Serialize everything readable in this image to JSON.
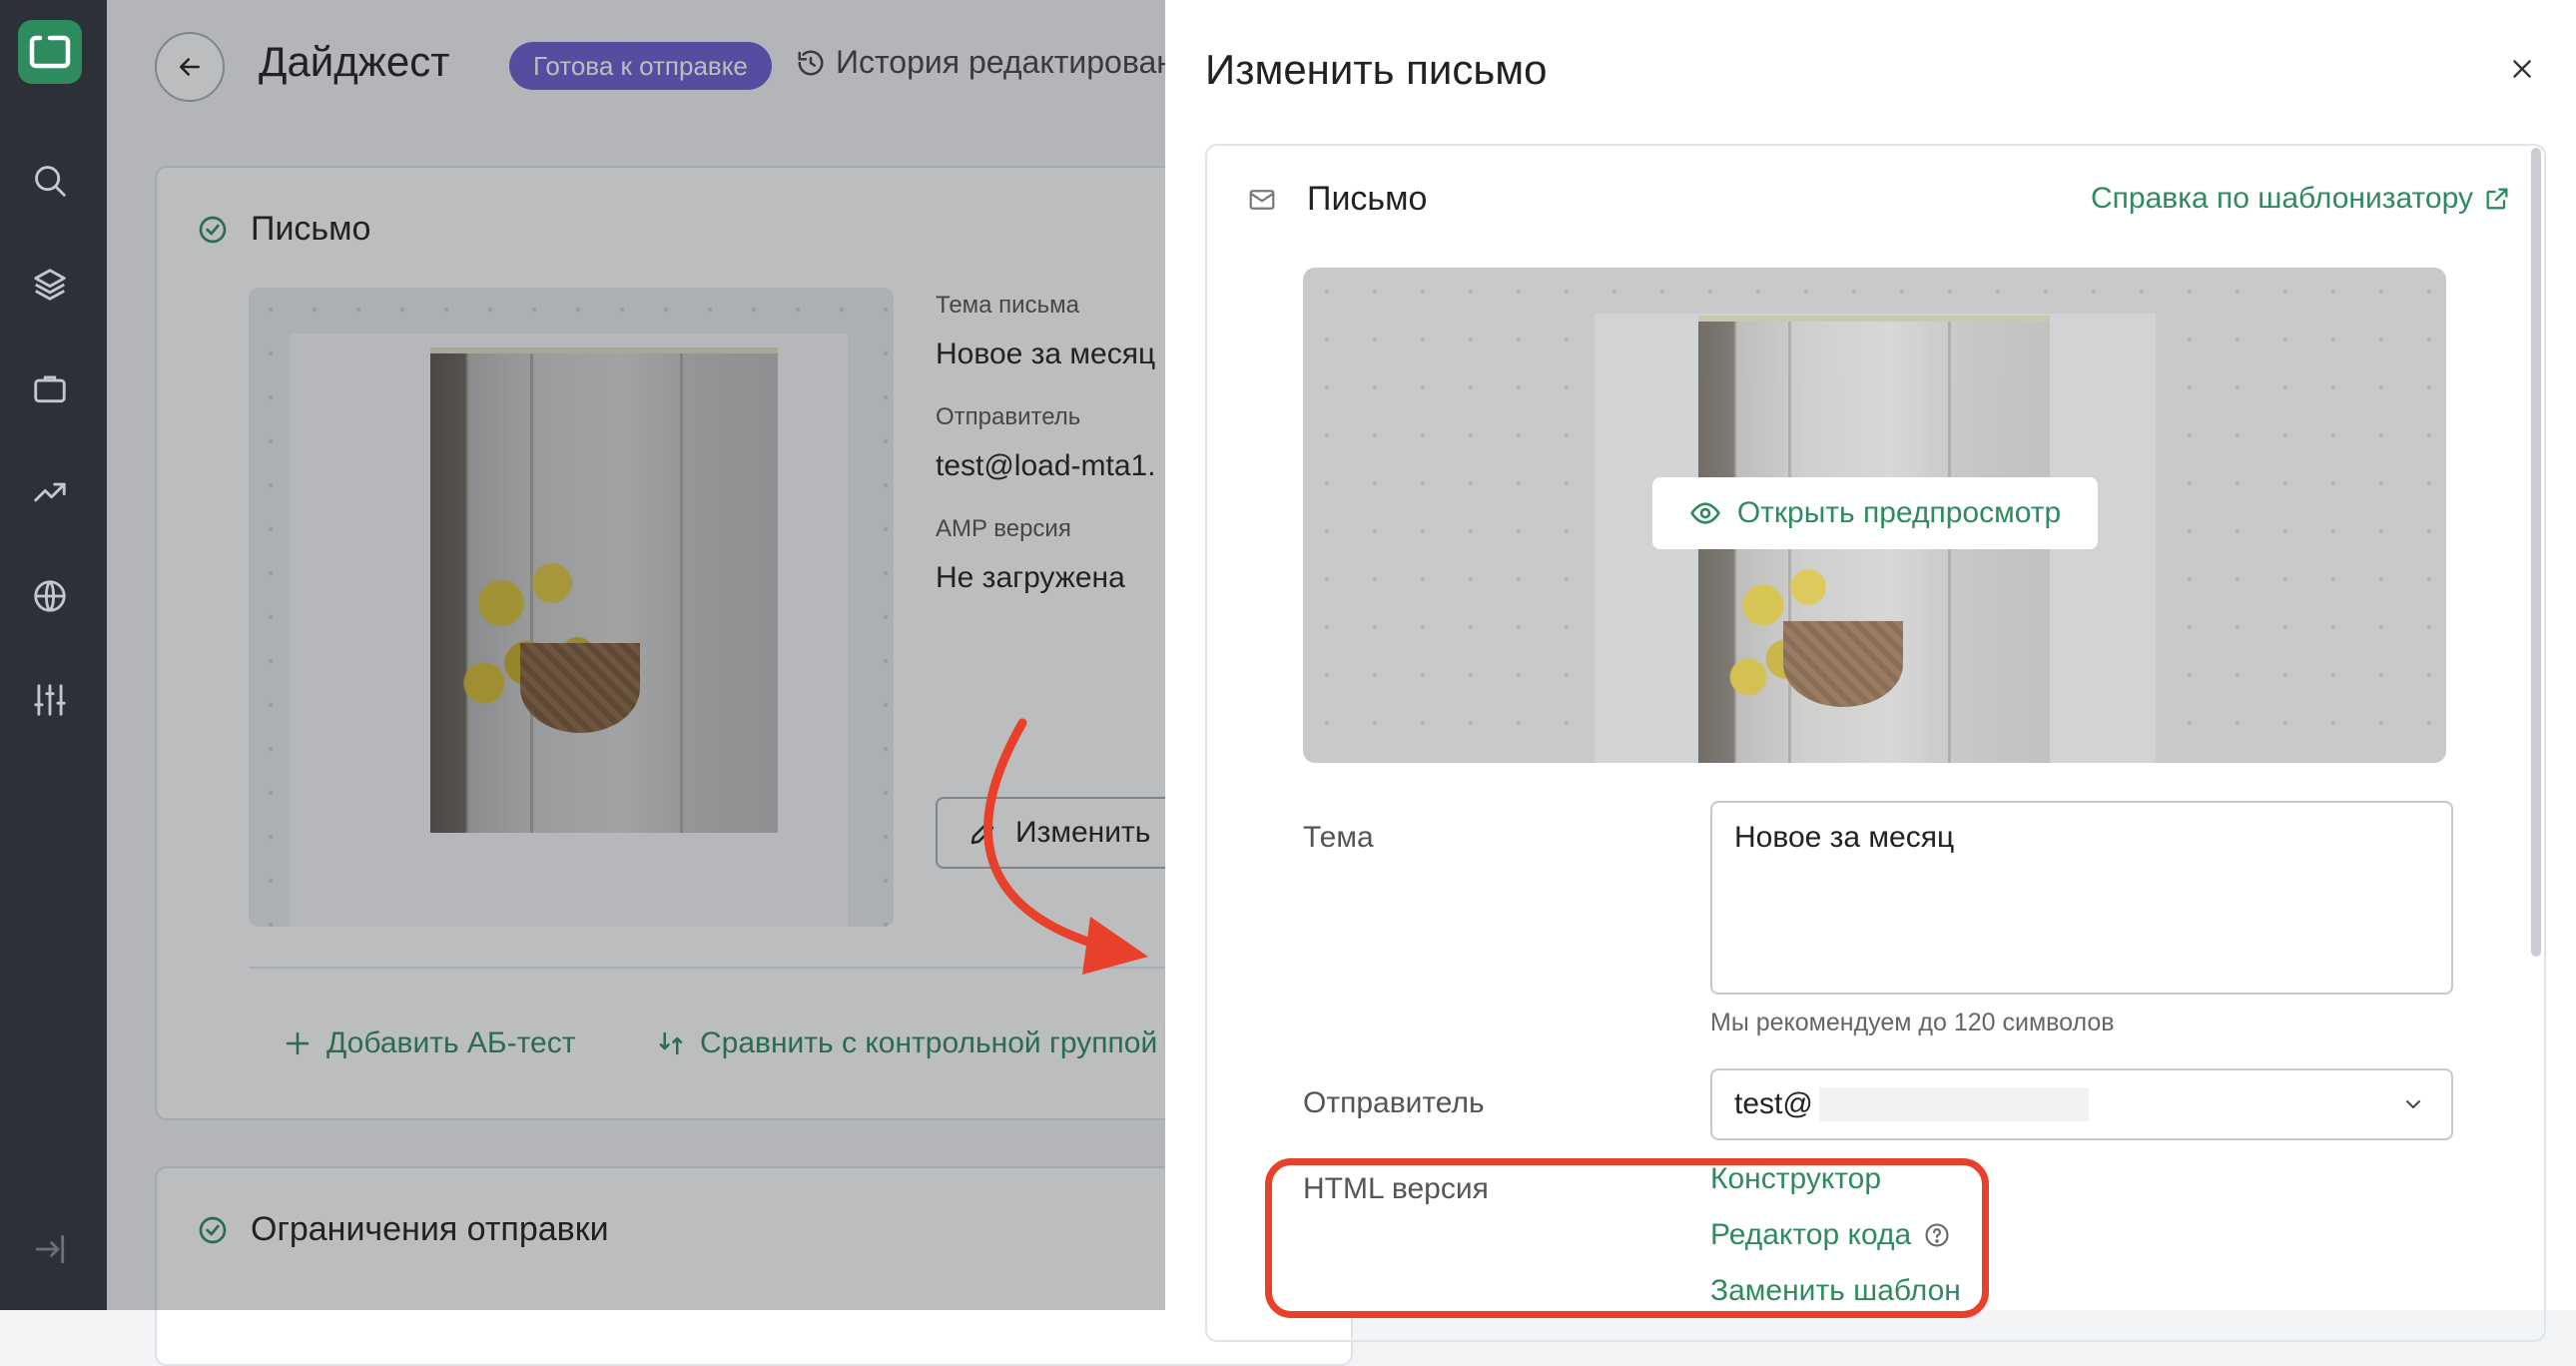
{
  "colors": {
    "accent": "#2e8b5e",
    "badge": "#6d5fd3",
    "highlight": "#e8402a",
    "rail": "#2c3138"
  },
  "rail": {
    "icons": [
      "search-icon",
      "layers-icon",
      "briefcase-icon",
      "trending-up-icon",
      "globe-icon",
      "sliders-icon",
      "logout-icon"
    ]
  },
  "page": {
    "title": "Дайджест",
    "status": "Готова к отправке",
    "history": "История редактирован",
    "letter_card": {
      "title": "Письмо",
      "subject_label": "Тема письма",
      "subject_value": "Новое за месяц",
      "sender_label": "Отправитель",
      "sender_value": "test@load-mta1.",
      "amp_label": "AMP версия",
      "amp_value": "Не загружена",
      "edit_button": "Изменить",
      "add_ab_test": "Добавить АБ-тест",
      "compare_control": "Сравнить с контрольной группой"
    },
    "limits_card": {
      "title": "Ограничения отправки"
    }
  },
  "drawer": {
    "title": "Изменить письмо",
    "card_title": "Письмо",
    "help_link": "Справка по шаблонизатору",
    "preview_button": "Открыть предпросмотр",
    "topic_label": "Тема",
    "topic_value": "Новое за месяц",
    "topic_hint": "Мы рекомендуем до 120 символов",
    "sender_label": "Отправитель",
    "sender_value": "test@",
    "html_label": "HTML версия",
    "html_options": {
      "constructor": "Конструктор",
      "code_editor": "Редактор кода",
      "replace_template": "Заменить шаблон"
    }
  }
}
